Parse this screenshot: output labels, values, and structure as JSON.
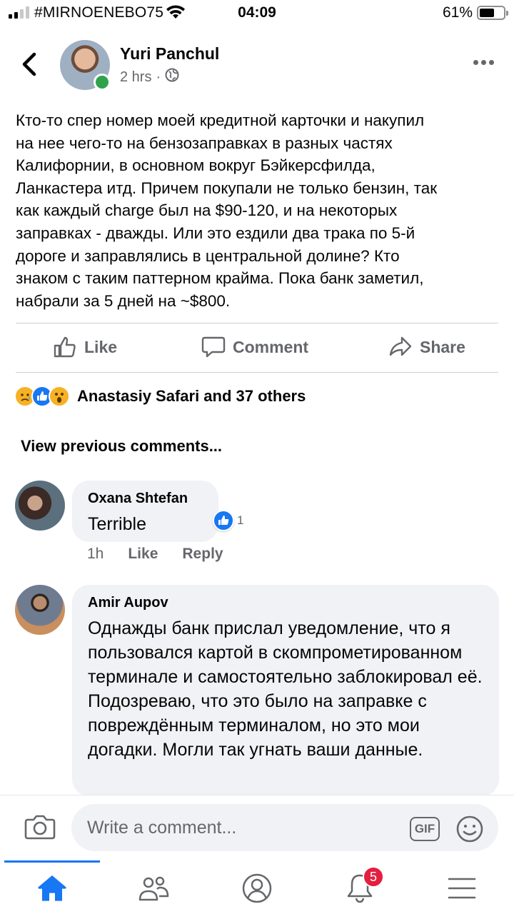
{
  "status_bar": {
    "carrier": "#MIRNOENEBO75",
    "time": "04:09",
    "battery_percent": "61%",
    "battery_level": 0.61
  },
  "post": {
    "author": "Yuri Panchul",
    "time_ago": "2 hrs",
    "separator": "·",
    "audience_icon": "globe-icon",
    "body": "Кто-то спер номер моей кредитной карточки и накупил\nна нее чего-то на бензозаправках в разных частях\nКалифорнии,  в основном вокруг Бэйкерсфилда,\nЛанкастера итд. Причем покупали не только бензин, так\nкак каждый charge был на $90-120, и на некоторых\nзаправках - дважды. Или это ездили два трака по 5-й\nдороге и заправлялись в центральной долине? Кто\nзнаком с таким паттерном крайма. Пока банк заметил,\nнабрали за 5 дней на ~$800."
  },
  "actions": {
    "like": "Like",
    "comment": "Comment",
    "share": "Share"
  },
  "reactions": {
    "types": [
      "sad",
      "like",
      "wow"
    ],
    "summary": "Anastasiy Safari and 37 others"
  },
  "comments_section": {
    "view_previous": "View previous comments...",
    "comments": [
      {
        "author": "Oxana Shtefan",
        "text": "Terrible",
        "reaction_count": "1",
        "time": "1h",
        "like_label": "Like",
        "reply_label": "Reply"
      },
      {
        "author": "Amir Aupov",
        "text": "Однажды банк прислал уведомление, что я пользовался картой в скомпрометированном терминале и самостоятельно заблокировал её. Подозреваю, что это было на заправке с повреждённым терминалом, но это мои догадки. Могли так угнать ваши данные."
      }
    ]
  },
  "composer": {
    "placeholder": "Write a comment...",
    "gif_label": "GIF"
  },
  "nav": {
    "items": [
      "home-icon",
      "friends-icon",
      "profile-icon",
      "notifications-icon",
      "menu-icon"
    ],
    "active": "home-icon",
    "notifications_badge": "5"
  },
  "colors": {
    "accent": "#1877f2",
    "secondary_text": "#65676b",
    "bubble": "#f0f2f5",
    "online": "#31a24c",
    "badge": "#e41e3f"
  }
}
